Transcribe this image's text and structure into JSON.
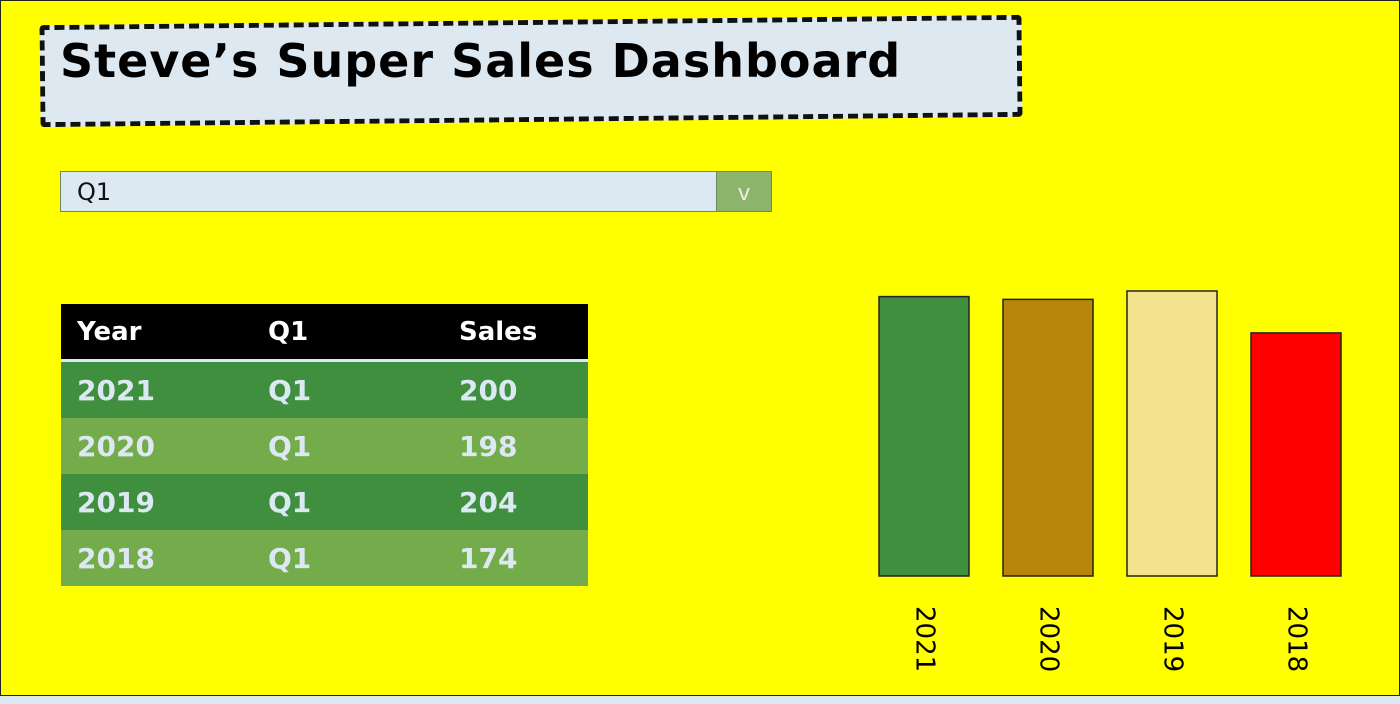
{
  "title": "Steve’s Super Sales Dashboard",
  "dropdown": {
    "selected": "Q1",
    "button_glyph": "v"
  },
  "table": {
    "headers": [
      "Year",
      "Q1",
      "Sales"
    ],
    "rows": [
      [
        "2021",
        "Q1",
        "200"
      ],
      [
        "2020",
        "Q1",
        "198"
      ],
      [
        "2019",
        "Q1",
        "204"
      ],
      [
        "2018",
        "Q1",
        "174"
      ]
    ]
  },
  "colors": {
    "background": "#ffff00",
    "header": "#000000",
    "row_dark": "#3f8f3f",
    "row_light": "#74ab4b"
  },
  "chart_data": {
    "type": "bar",
    "categories": [
      "2021",
      "2020",
      "2019",
      "2018"
    ],
    "values": [
      200,
      198,
      204,
      174
    ],
    "colors": [
      "#3f8f3f",
      "#b8860b",
      "#f3e38f",
      "#ff0000"
    ],
    "title": "",
    "xlabel": "",
    "ylabel": "",
    "ylim": [
      0,
      204
    ],
    "grid": false,
    "legend": "none"
  }
}
